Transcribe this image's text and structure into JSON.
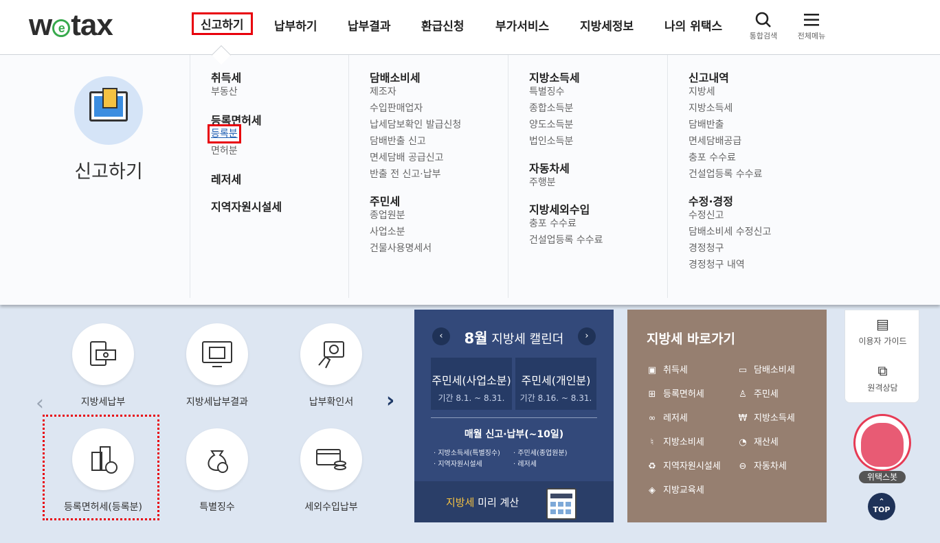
{
  "header": {
    "logo": "wetax",
    "nav": [
      "신고하기",
      "납부하기",
      "납부결과",
      "환급신청",
      "부가서비스",
      "지방세정보",
      "나의 위택스"
    ],
    "search_label": "통합검색",
    "menu_label": "전체메뉴"
  },
  "mega": {
    "title": "신고하기",
    "col1": {
      "cat1": "취득세",
      "cat1_items": [
        "부동산"
      ],
      "cat2": "등록면허세",
      "cat2_items": [
        "등록분",
        "면허분"
      ],
      "cat3": "레저세",
      "cat4": "지역자원시설세"
    },
    "col2": {
      "cat1": "담배소비세",
      "cat1_items": [
        "제조자",
        "수입판매업자",
        "납세담보확인 발급신청",
        "담배반출 신고",
        "면세담배 공급신고",
        "반출 전 신고·납부"
      ],
      "cat2": "주민세",
      "cat2_items": [
        "종업원분",
        "사업소분",
        "건물사용명세서"
      ]
    },
    "col3": {
      "cat1": "지방소득세",
      "cat1_items": [
        "특별징수",
        "종합소득분",
        "양도소득분",
        "법인소득분"
      ],
      "cat2": "자동차세",
      "cat2_items": [
        "주행분"
      ],
      "cat3": "지방세외수입",
      "cat3_items": [
        "충포 수수료",
        "건설업등록 수수료"
      ]
    },
    "col4": {
      "cat1": "신고내역",
      "cat1_items": [
        "지방세",
        "지방소득세",
        "담배반출",
        "면세담배공급",
        "충포 수수료",
        "건설업등록 수수료"
      ],
      "cat2": "수정·경정",
      "cat2_items": [
        "수정신고",
        "담배소비세 수정신고",
        "경정청구",
        "경정청구 내역"
      ]
    }
  },
  "quick_menu": [
    "지방세납부",
    "지방세납부결과",
    "납부확인서",
    "등록면허세(등록분)",
    "특별징수",
    "세외수입납부"
  ],
  "calendar": {
    "month": "8월",
    "title": "지방세 캘린더",
    "box1": {
      "title": "주민세(사업소분)",
      "period": "기간 8.1. ~ 8.31."
    },
    "box2": {
      "title": "주민세(개인분)",
      "period": "기간 8.16. ~ 8.31."
    },
    "monthly": "매월 신고·납부(~10일)",
    "items": [
      "지방소득세(특별징수)",
      "주민세(종업원분)",
      "지역자원시설세",
      "레저세"
    ],
    "calc_prefix": "지방세",
    "calc_suffix": " 미리 계산"
  },
  "shortcut": {
    "title": "지방세 바로가기",
    "items": [
      "취득세",
      "담배소비세",
      "등록면허세",
      "주민세",
      "레저세",
      "지방소득세",
      "지방소비세",
      "재산세",
      "지역자원시설세",
      "자동차세",
      "지방교육세"
    ]
  },
  "side": {
    "guide": "이용자 가이드",
    "remote": "원격상담",
    "bot": "위택스봇",
    "top": "TOP"
  }
}
